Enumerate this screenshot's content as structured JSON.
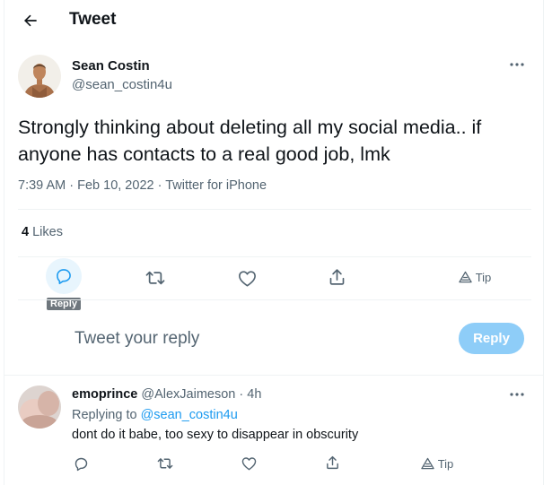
{
  "header": {
    "title": "Tweet",
    "back_icon": "arrow-left-icon"
  },
  "tweet": {
    "author_name": "Sean Costin",
    "author_handle": "@sean_costin4u",
    "text": "Strongly thinking about deleting all my social media.. if anyone has contacts to a real good job, lmk",
    "time": "7:39 AM",
    "date": "Feb 10, 2022",
    "source": "Twitter for iPhone",
    "separator": "·",
    "likes_count": "4",
    "likes_label": "Likes"
  },
  "actions": {
    "reply_icon": "reply-icon",
    "retweet_icon": "retweet-icon",
    "like_icon": "heart-icon",
    "share_icon": "share-icon",
    "tip_icon": "tip-icon",
    "tip_label": "Tip",
    "tooltip": "Reply"
  },
  "composer": {
    "placeholder": "Tweet your reply",
    "button_label": "Reply"
  },
  "reply": {
    "author_name": "emoprince",
    "author_handle": "@AlexJaimeson",
    "time_sep": "·",
    "time": "4h",
    "replying_label": "Replying to",
    "replying_handle": "@sean_costin4u",
    "text": "dont do it babe, too sexy to disappear in obscurity",
    "tip_label": "Tip"
  },
  "colors": {
    "accent": "#1d9bf0",
    "reply_button": "#8ecdf8",
    "muted": "#536471",
    "text": "#0f1419"
  }
}
